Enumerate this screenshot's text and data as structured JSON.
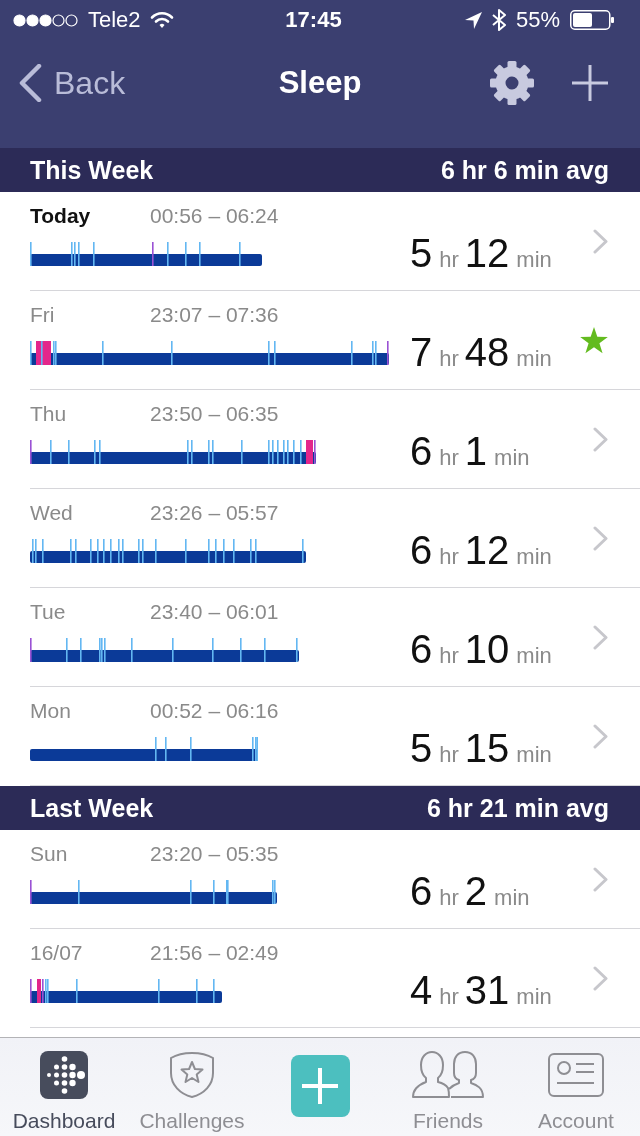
{
  "status_bar": {
    "carrier": "Tele2",
    "time": "17:45",
    "battery": "55%"
  },
  "nav": {
    "back": "Back",
    "title": "Sleep"
  },
  "sections": [
    {
      "title": "This Week",
      "average": "6 hr 6 min avg",
      "rows": [
        {
          "day": "Today",
          "time_range": "00:56 – 06:24",
          "hours": "5",
          "hours_unit": "hr",
          "minutes": "12",
          "minutes_unit": "min",
          "current": true,
          "goal_met": false
        },
        {
          "day": "Fri",
          "time_range": "23:07 – 07:36",
          "hours": "7",
          "hours_unit": "hr",
          "minutes": "48",
          "minutes_unit": "min",
          "current": false,
          "goal_met": true
        },
        {
          "day": "Thu",
          "time_range": "23:50 – 06:35",
          "hours": "6",
          "hours_unit": "hr",
          "minutes": "1",
          "minutes_unit": "min",
          "current": false,
          "goal_met": false
        },
        {
          "day": "Wed",
          "time_range": "23:26 – 05:57",
          "hours": "6",
          "hours_unit": "hr",
          "minutes": "12",
          "minutes_unit": "min",
          "current": false,
          "goal_met": false
        },
        {
          "day": "Tue",
          "time_range": "23:40 – 06:01",
          "hours": "6",
          "hours_unit": "hr",
          "minutes": "10",
          "minutes_unit": "min",
          "current": false,
          "goal_met": false
        },
        {
          "day": "Mon",
          "time_range": "00:52 – 06:16",
          "hours": "5",
          "hours_unit": "hr",
          "minutes": "15",
          "minutes_unit": "min",
          "current": false,
          "goal_met": false
        }
      ]
    },
    {
      "title": "Last Week",
      "average": "6 hr 21 min avg",
      "rows": [
        {
          "day": "Sun",
          "time_range": "23:20 – 05:35",
          "hours": "6",
          "hours_unit": "hr",
          "minutes": "2",
          "minutes_unit": "min",
          "current": false,
          "goal_met": false
        },
        {
          "day": "16/07",
          "time_range": "21:56 – 02:49",
          "hours": "4",
          "hours_unit": "hr",
          "minutes": "31",
          "minutes_unit": "min",
          "current": false,
          "goal_met": false
        }
      ]
    }
  ],
  "tabs": [
    {
      "label": "Dashboard",
      "selected": true
    },
    {
      "label": "Challenges",
      "selected": false
    },
    {
      "label": "Friends",
      "selected": false
    },
    {
      "label": "Account",
      "selected": false
    }
  ]
}
